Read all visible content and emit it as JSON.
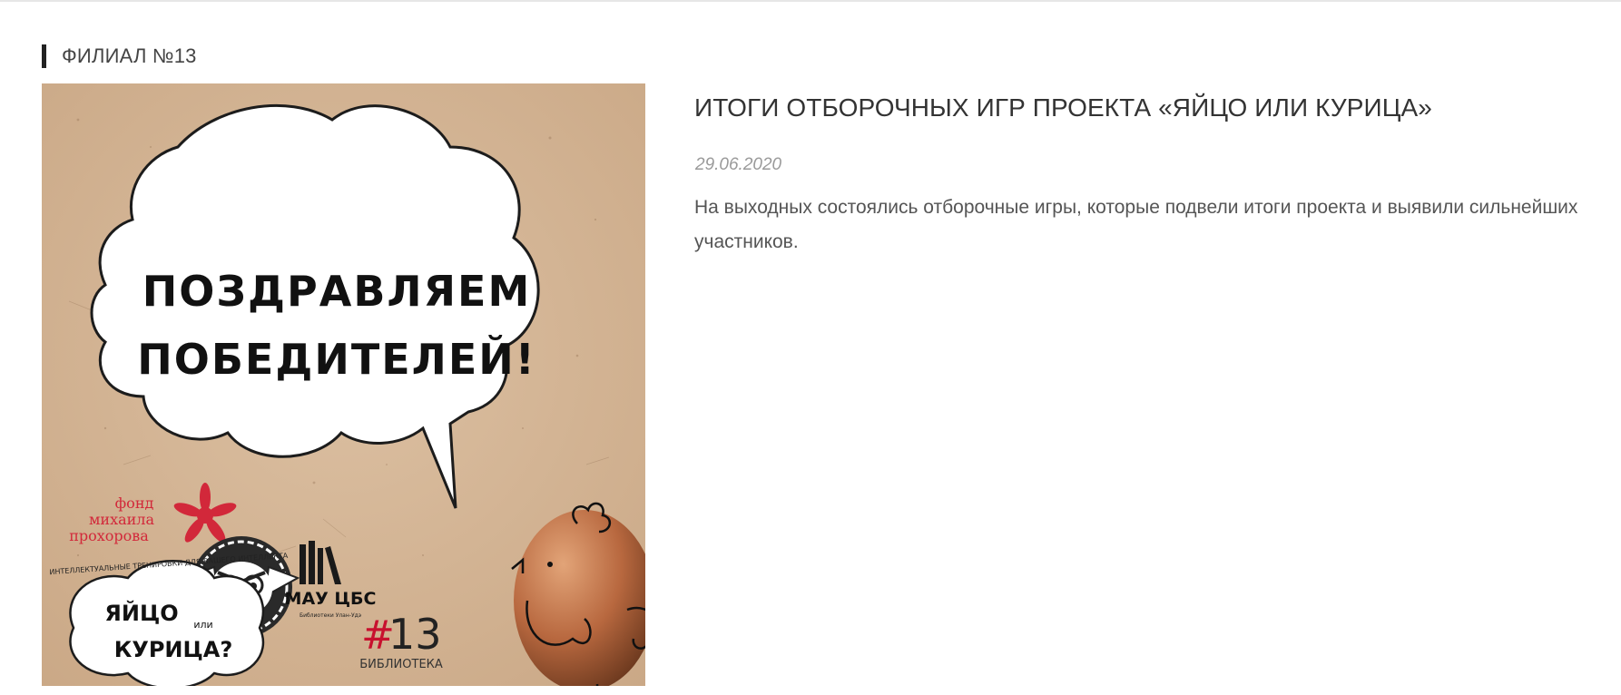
{
  "section": {
    "label": "ФИЛИАЛ №13"
  },
  "post": {
    "title": "ИТОГИ ОТБОРОЧНЫХ ИГР ПРОЕКТА «ЯЙЦО ИЛИ КУРИЦА»",
    "date": "29.06.2020",
    "excerpt": "На выходных состоялись отборочные игры, которые подвели итоги проекта и выявили сильнейших участников."
  },
  "poster": {
    "headline_line1": "ПОЗДРАВЛЯЕМ",
    "headline_line2": "ПОБЕДИТЕЛЕЙ!",
    "fund_line1": "фонд",
    "fund_line2": "михаила",
    "fund_line3": "прохорова",
    "project_arc": "ИНТЕЛЛЕКТУАЛЬНЫЕ ТРЕНИРОВКИ ДЛЯ ВАШЕГО ИНТЕЛЛЕКТА",
    "project_line1": "ЯЙЦО",
    "project_or": "или",
    "project_line2": "КУРИЦА?",
    "mau_label": "МАУ ЦБС",
    "mau_sub": "Библиотеки Улан-Удэ",
    "branch_hash": "#",
    "branch_num": "13",
    "branch_label": "БИБЛИОТЕКА",
    "colors": {
      "kraft": "#d8b99a",
      "fund_red": "#d2283a",
      "hash_red": "#c8102e"
    }
  }
}
